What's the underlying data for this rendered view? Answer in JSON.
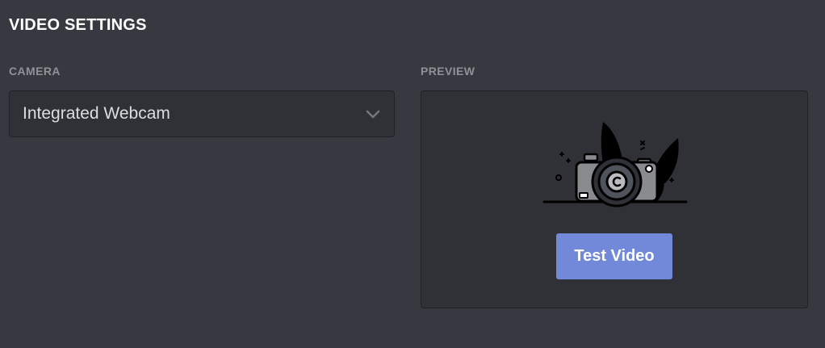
{
  "section": {
    "title": "VIDEO SETTINGS"
  },
  "camera": {
    "label": "CAMERA",
    "selected": "Integrated Webcam",
    "dropdown_icon": "chevron-down-icon"
  },
  "preview": {
    "label": "PREVIEW",
    "illustration_icon": "camera-illustration-icon",
    "button_label": "Test Video"
  },
  "colors": {
    "background": "#36393f",
    "panel": "#2f3136",
    "accent": "#7289da",
    "label": "#8e9297",
    "text": "#dcddde"
  }
}
